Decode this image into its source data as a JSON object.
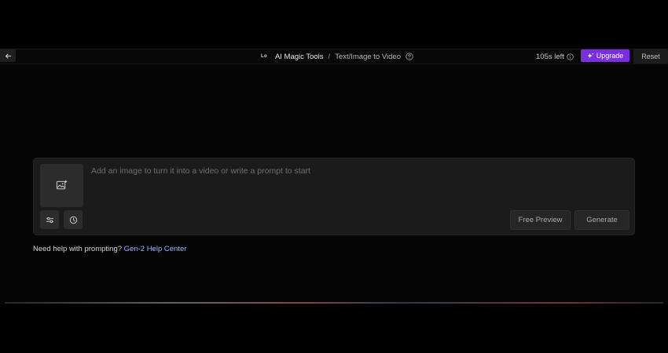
{
  "topbar": {
    "logo_text": "Lo",
    "breadcrumb_root": "AI Magic Tools",
    "breadcrumb_separator": "/",
    "breadcrumb_current": "Text/Image to Video",
    "credits_text": "105s left",
    "upgrade_label": "Upgrade",
    "reset_label": "Reset"
  },
  "prompt": {
    "placeholder": "Add an image to turn it into a video or write a prompt to start",
    "value": "",
    "free_preview_label": "Free Preview",
    "generate_label": "Generate"
  },
  "help": {
    "text": "Need help with prompting?",
    "link_label": "Gen-2 Help Center"
  },
  "icons": {
    "back": "arrow-left-icon",
    "help": "question-circle-icon",
    "info": "info-circle-icon",
    "upgrade": "sparkle-icon",
    "image": "image-upload-icon",
    "settings": "sliders-icon",
    "history": "clock-icon"
  },
  "colors": {
    "accent": "#7a2ee0",
    "link": "#a9b4ff",
    "card_bg": "#1b1b1b",
    "page_bg": "#000000"
  }
}
